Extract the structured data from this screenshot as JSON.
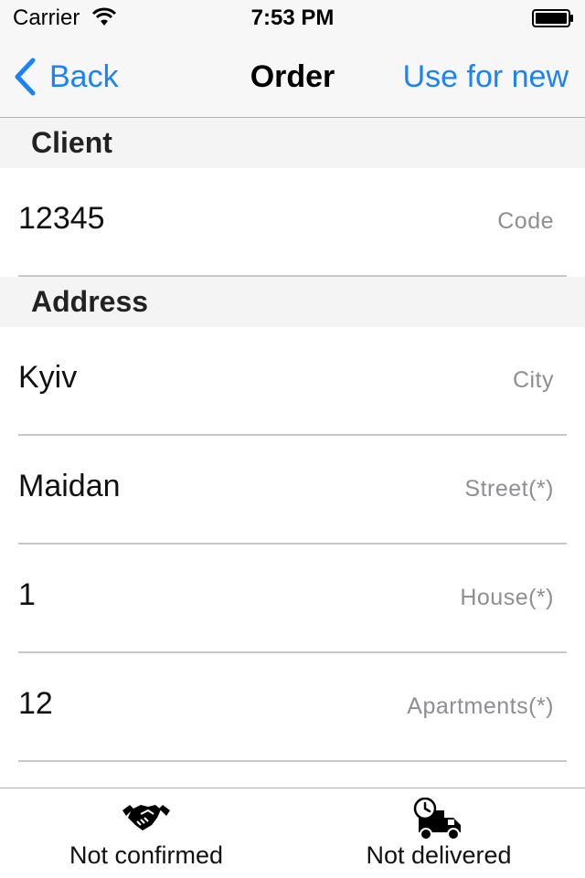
{
  "status_bar": {
    "carrier": "Carrier",
    "time": "7:53 PM"
  },
  "nav": {
    "back_label": "Back",
    "title": "Order",
    "right_action": "Use for new"
  },
  "sections": {
    "client": {
      "header": "Client",
      "code": {
        "value": "12345",
        "placeholder": "Code"
      }
    },
    "address": {
      "header": "Address",
      "city": {
        "value": "Kyiv",
        "placeholder": "City"
      },
      "street": {
        "value": "Maidan",
        "placeholder": "Street(*)"
      },
      "house": {
        "value": "1",
        "placeholder": "House(*)"
      },
      "apartments": {
        "value": "12",
        "placeholder": "Apartments(*)"
      }
    }
  },
  "tabs": [
    {
      "label": "Not confirmed",
      "icon": "handshake-icon"
    },
    {
      "label": "Not delivered",
      "icon": "delivery-truck-clock-icon"
    }
  ],
  "colors": {
    "accent": "#1a82fb",
    "bar_background": "#f7f7f7",
    "section_background": "#f4f4f4",
    "placeholder": "#8e8e93"
  }
}
